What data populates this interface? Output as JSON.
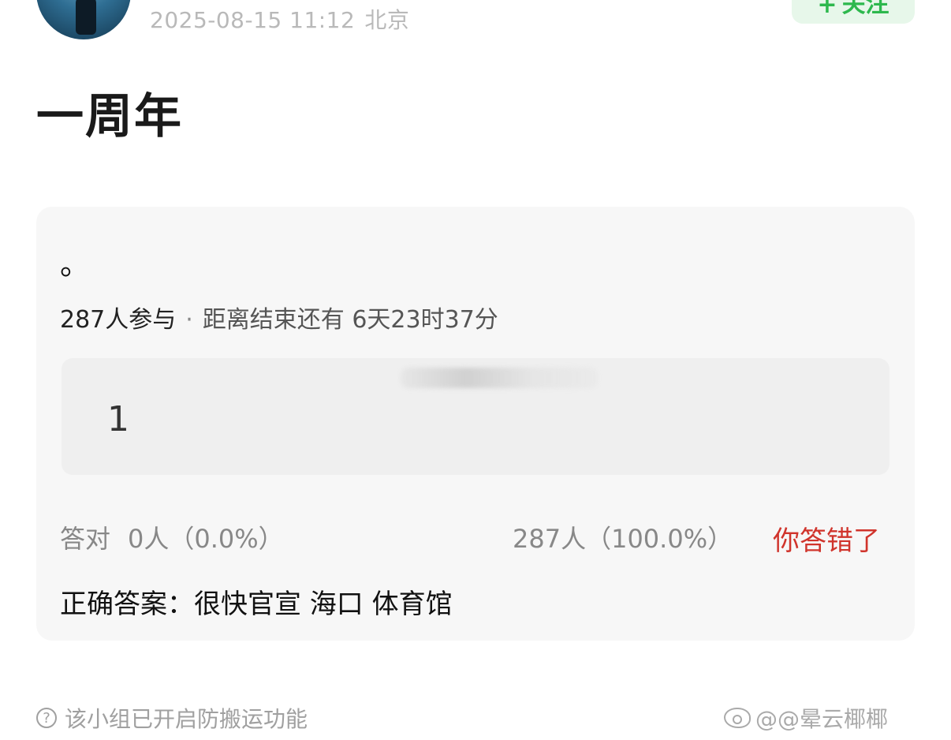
{
  "post": {
    "timestamp": "2025-08-15 11:12",
    "location": "北京",
    "follow_label": "关注",
    "title": "一周年"
  },
  "quiz": {
    "question": "。",
    "participants": "287人参与",
    "separator": "·",
    "remaining": "距离结束还有 6天23时37分",
    "option_label": "1",
    "correct_stats": "答对",
    "correct_count": "0人（0.0%）",
    "wrong_count": "287人（100.0%）",
    "result": "你答错了",
    "answer": "正确答案：很快官宣 海口 体育馆"
  },
  "footer": {
    "notice": "该小组已开启防搬运功能",
    "help_glyph": "?",
    "watermark": "@@晕云椰椰"
  },
  "icons": {
    "help": "question-circle-icon",
    "weibo": "weibo-icon",
    "plus": "plus-icon"
  },
  "colors": {
    "accent_green": "#2db84d",
    "wrong_red": "#d0342c"
  }
}
